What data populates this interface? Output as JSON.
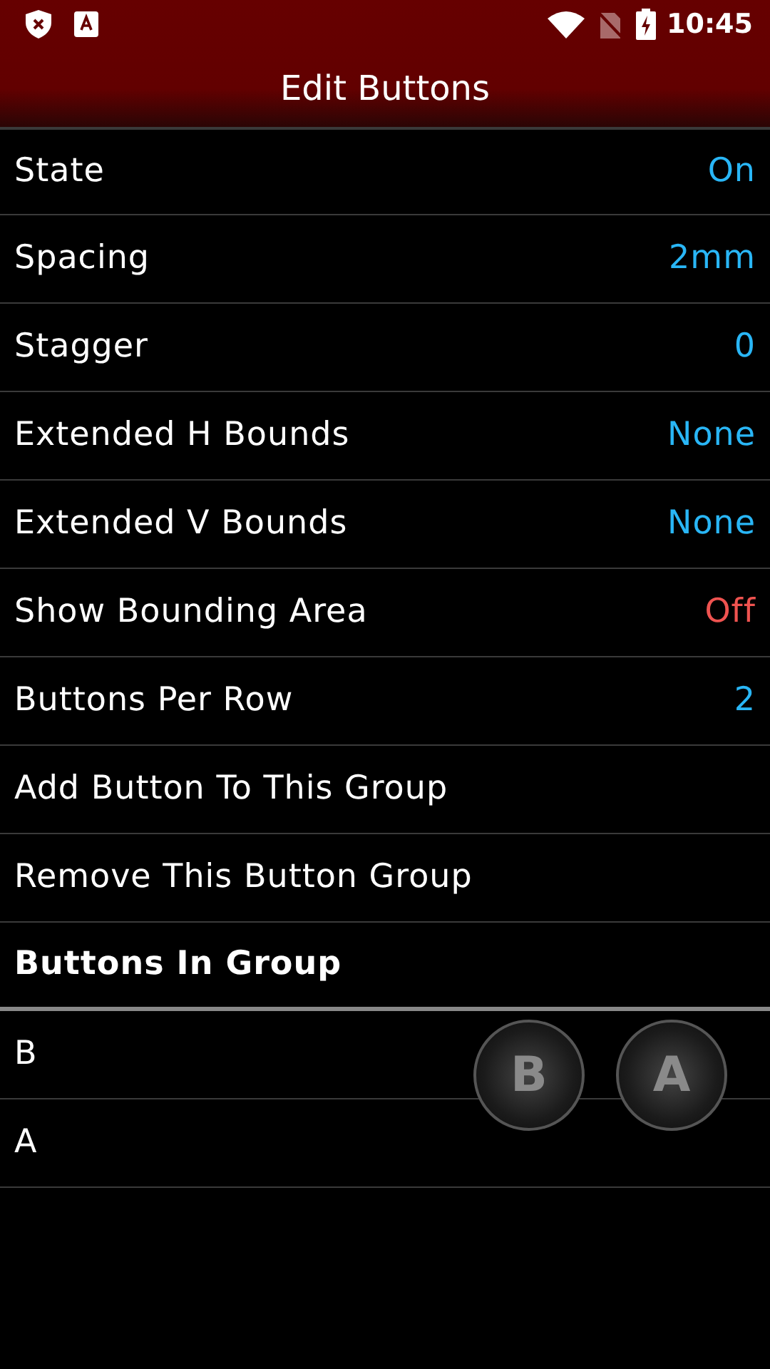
{
  "status_bar": {
    "time": "10:45"
  },
  "app_bar": {
    "title": "Edit Buttons"
  },
  "rows": [
    {
      "kind": "setting",
      "label": "State",
      "value": "On",
      "color": "#29b6f6"
    },
    {
      "kind": "setting",
      "label": "Spacing",
      "value": "2mm",
      "color": "#29b6f6"
    },
    {
      "kind": "setting",
      "label": "Stagger",
      "value": "0",
      "color": "#29b6f6"
    },
    {
      "kind": "setting",
      "label": "Extended H Bounds",
      "value": "None",
      "color": "#29b6f6"
    },
    {
      "kind": "setting",
      "label": "Extended V Bounds",
      "value": "None",
      "color": "#29b6f6"
    },
    {
      "kind": "setting",
      "label": "Show Bounding Area",
      "value": "Off",
      "color": "#ef5350"
    },
    {
      "kind": "setting",
      "label": "Buttons Per Row",
      "value": "2",
      "color": "#29b6f6"
    },
    {
      "kind": "action",
      "label": "Add Button To This Group"
    },
    {
      "kind": "action",
      "label": "Remove This Button Group"
    },
    {
      "kind": "header",
      "label": "Buttons In Group"
    },
    {
      "kind": "item",
      "label": "B"
    },
    {
      "kind": "item",
      "label": "A"
    }
  ],
  "preview_buttons": [
    "B",
    "A"
  ]
}
